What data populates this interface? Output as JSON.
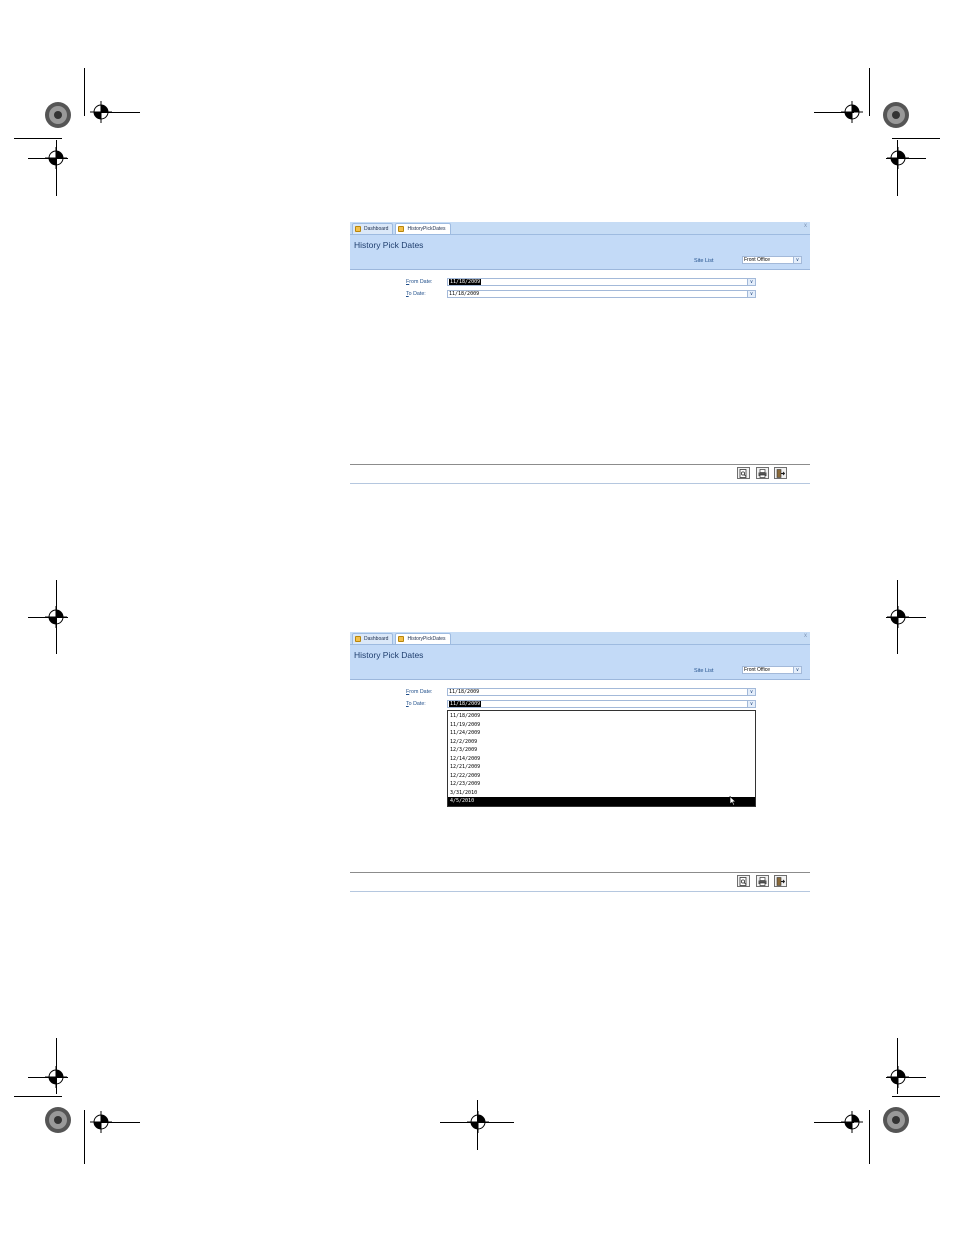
{
  "screens": [
    {
      "tabs": [
        {
          "label": "Dashboard",
          "active": false
        },
        {
          "label": "HistoryPickDates",
          "active": true
        }
      ],
      "close_glyph": "x",
      "title": "History Pick Dates",
      "site_list": {
        "label": "Site List",
        "value": "Front Office"
      },
      "from_date": {
        "label_prefix": "",
        "label_accel": "F",
        "label_rest": "rom Date:",
        "value": "11/18/2009",
        "selected": true
      },
      "to_date": {
        "label_prefix": "",
        "label_accel": "T",
        "label_rest": "o Date:",
        "value": "11/18/2009",
        "selected": false
      },
      "toolbar": [
        "preview-icon",
        "print-icon",
        "exit-icon"
      ]
    },
    {
      "tabs": [
        {
          "label": "Dashboard",
          "active": false
        },
        {
          "label": "HistoryPickDates",
          "active": true
        }
      ],
      "close_glyph": "x",
      "title": "History Pick Dates",
      "site_list": {
        "label": "Site List",
        "value": "Front Office"
      },
      "from_date": {
        "label_prefix": "",
        "label_accel": "F",
        "label_rest": "rom Date:",
        "value": "11/18/2009",
        "selected": false
      },
      "to_date": {
        "label_prefix": "",
        "label_accel": "T",
        "label_rest": "o Date:",
        "value": "11/18/2009",
        "selected": true
      },
      "to_date_options": [
        "11/18/2009",
        "11/19/2009",
        "11/24/2009",
        "12/2/2009",
        "12/3/2009",
        "12/14/2009",
        "12/21/2009",
        "12/22/2009",
        "12/23/2009",
        "3/31/2010",
        "4/5/2010"
      ],
      "highlighted_option": "4/5/2010",
      "toolbar": [
        "preview-icon",
        "print-icon",
        "exit-icon"
      ]
    }
  ]
}
